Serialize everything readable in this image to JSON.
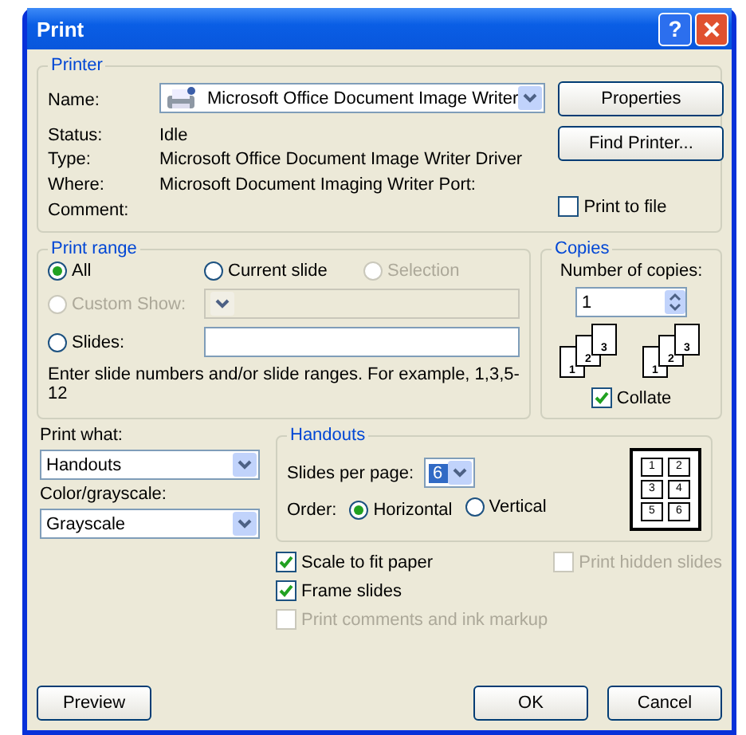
{
  "window": {
    "title": "Print",
    "help_button": "?"
  },
  "printer": {
    "title": "Printer",
    "name_label": "Name:",
    "name_value": "Microsoft Office Document Image Writer",
    "info": [
      {
        "label": "Status:",
        "value": "Idle"
      },
      {
        "label": "Type:",
        "value": "Microsoft Office Document Image Writer Driver"
      },
      {
        "label": "Where:",
        "value": "Microsoft Document Imaging Writer Port:"
      },
      {
        "label": "Comment:"
      }
    ],
    "buttons": [
      "Properties",
      "Find Printer..."
    ],
    "print_to_file": {
      "label": "Print to file",
      "checked": false
    }
  },
  "print_range": {
    "title": "Print range",
    "options": [
      {
        "kind": "radio",
        "label": "All",
        "selected": true,
        "disabled": false
      },
      {
        "kind": "radio",
        "label": "Current slide",
        "selected": false,
        "disabled": false
      },
      {
        "kind": "radio",
        "label": "Selection",
        "selected": false,
        "disabled": true
      },
      {
        "kind": "radio_dropdown",
        "label": "Custom Show:",
        "selected": false,
        "disabled": true
      },
      {
        "kind": "radio_field",
        "label": "Slides:",
        "selected": false,
        "disabled": false
      }
    ],
    "hint": "Enter slide numbers and/or slide ranges. For example, 1,3,5-12"
  },
  "copies": {
    "title": "Copies",
    "number_label": "Number of copies:",
    "number_value": "1",
    "illustration": [
      [
        "1",
        "2",
        "3"
      ],
      [
        "1",
        "2",
        "3"
      ]
    ],
    "collate": {
      "label": "Collate",
      "checked": true
    }
  },
  "print_what": {
    "label": "Print what:",
    "value": "Handouts"
  },
  "color": {
    "label": "Color/grayscale:",
    "value": "Grayscale"
  },
  "handouts": {
    "title": "Handouts",
    "per_page_label": "Slides per page:",
    "per_page_value": "6",
    "order_label": "Order:",
    "orders": [
      {
        "label": "Horizontal",
        "selected": true
      },
      {
        "label": "Vertical",
        "selected": false
      }
    ],
    "preview": [
      "1",
      "2",
      "3",
      "4",
      "5",
      "6"
    ]
  },
  "options": {
    "main": [
      {
        "label": "Scale to fit paper",
        "checked": true,
        "disabled": false
      },
      {
        "label": "Frame slides",
        "checked": true,
        "disabled": false
      },
      {
        "label": "Print comments and ink markup",
        "checked": false,
        "disabled": true
      }
    ],
    "side": [
      {
        "label": "Print hidden slides",
        "checked": false,
        "disabled": true
      }
    ]
  },
  "buttons": [
    {
      "kind": "left",
      "label": "Preview"
    },
    {
      "kind": "right",
      "label": "OK"
    },
    {
      "kind": "right",
      "label": "Cancel"
    }
  ]
}
